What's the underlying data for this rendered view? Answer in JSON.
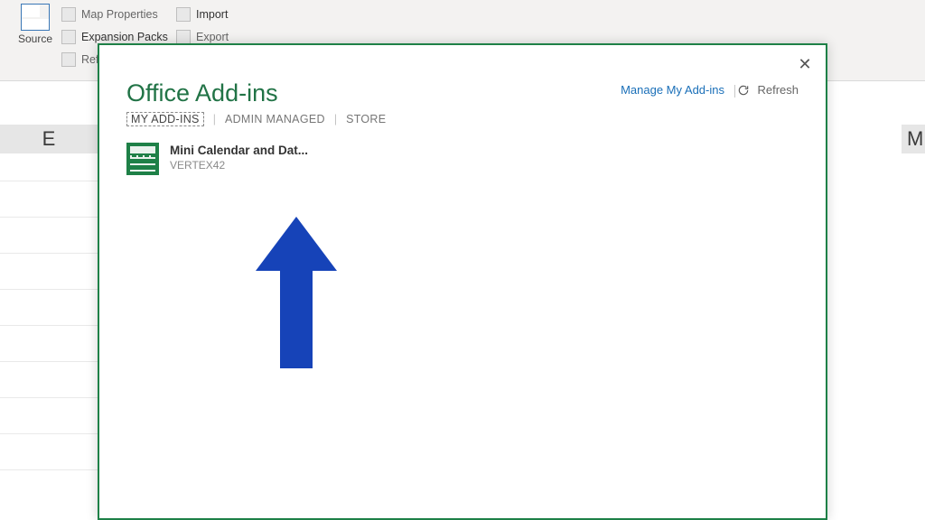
{
  "ribbon": {
    "source_label": "Source",
    "map_properties": "Map Properties",
    "expansion_packs": "Expansion Packs",
    "refresh": "Refr",
    "import": "Import",
    "export": "Export"
  },
  "sheet": {
    "col_e": "E",
    "col_m": "M"
  },
  "modal": {
    "title": "Office Add-ins",
    "tabs": {
      "my": "MY ADD-INS",
      "admin": "ADMIN MANAGED",
      "store": "STORE"
    },
    "manage_link": "Manage My Add-ins",
    "refresh_label": "Refresh",
    "close_glyph": "✕",
    "addins": [
      {
        "name": "Mini Calendar and Dat...",
        "publisher": "VERTEX42"
      }
    ]
  },
  "colors": {
    "accent": "#217346",
    "link": "#1a6fb8",
    "arrow": "#1643b8"
  }
}
